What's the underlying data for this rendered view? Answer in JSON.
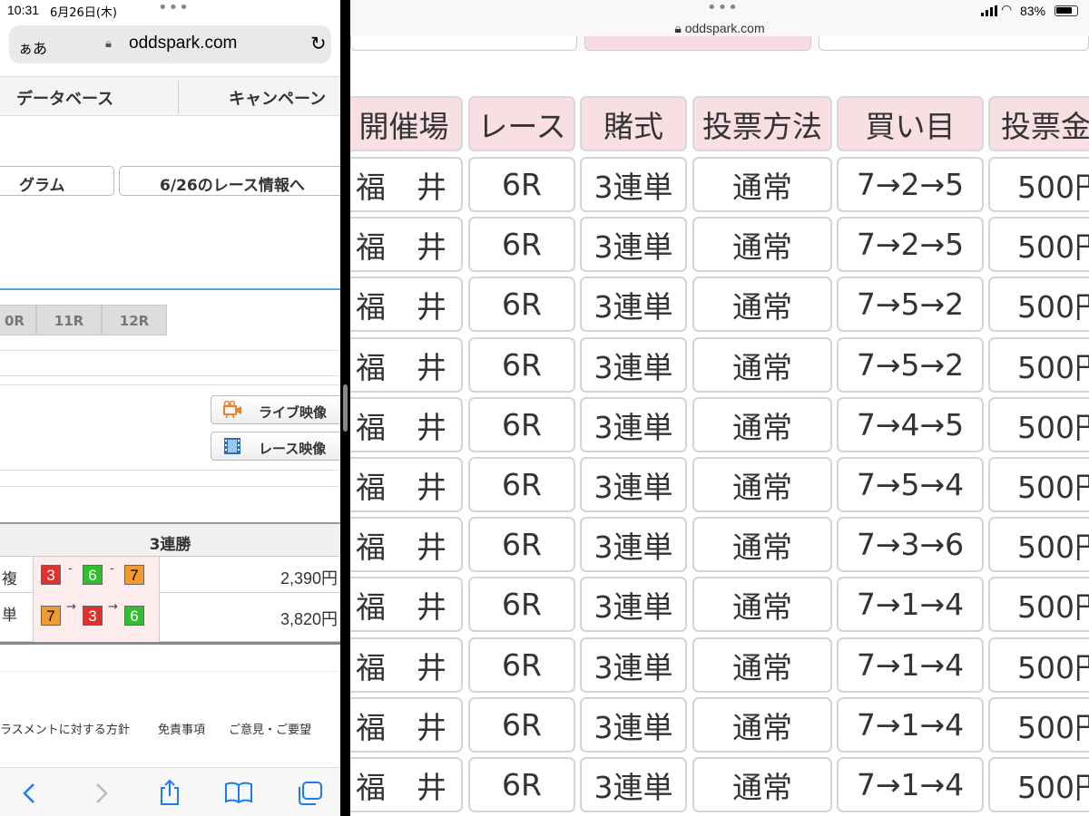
{
  "left_pane": {
    "status": {
      "time": "10:31",
      "date": "6月26日(木)"
    },
    "url_bar": {
      "aa": "ぁあ",
      "domain": "oddspark.com"
    },
    "nav_tabs": [
      "データベース",
      "キャンペーン"
    ],
    "program_buttons": [
      "グラム",
      "6/26のレース情報へ"
    ],
    "race_tabs": [
      "0R",
      "11R",
      "12R"
    ],
    "video_buttons": [
      {
        "label": "ライブ映像",
        "icon": "video-camera-icon"
      },
      {
        "label": "レース映像",
        "icon": "film-icon"
      }
    ],
    "results": {
      "header": "3連勝",
      "rows": [
        {
          "kind": "複",
          "numbers": [
            "3",
            "6",
            "7"
          ],
          "colors": [
            "#e03030",
            "#2ec02e",
            "#f29a2e"
          ],
          "separator": "-",
          "amount": "2,390円"
        },
        {
          "kind": "単",
          "numbers": [
            "7",
            "3",
            "6"
          ],
          "colors": [
            "#f29a2e",
            "#e03030",
            "#2ec02e"
          ],
          "separator": "→",
          "amount": "3,820円"
        }
      ]
    },
    "footer_links": [
      "ラスメントに対する方針",
      "免責事項",
      "ご意見・ご要望"
    ],
    "browser_toolbar": [
      "back-icon",
      "forward-icon",
      "share-icon",
      "bookmarks-icon",
      "tabs-icon"
    ]
  },
  "right_pane": {
    "status": {
      "battery": "83%",
      "battery_level": 0.83,
      "domain": "oddspark.com"
    },
    "table": {
      "headers": [
        "開催場",
        "レース",
        "賭式",
        "投票方法",
        "買い目",
        "投票金"
      ],
      "rows": [
        [
          "福井",
          "6R",
          "3連単",
          "通常",
          "7→2→5",
          "500円"
        ],
        [
          "福井",
          "6R",
          "3連単",
          "通常",
          "7→2→5",
          "500円"
        ],
        [
          "福井",
          "6R",
          "3連単",
          "通常",
          "7→5→2",
          "500円"
        ],
        [
          "福井",
          "6R",
          "3連単",
          "通常",
          "7→5→2",
          "500円"
        ],
        [
          "福井",
          "6R",
          "3連単",
          "通常",
          "7→4→5",
          "500円"
        ],
        [
          "福井",
          "6R",
          "3連単",
          "通常",
          "7→5→4",
          "500円"
        ],
        [
          "福井",
          "6R",
          "3連単",
          "通常",
          "7→3→6",
          "500円"
        ],
        [
          "福井",
          "6R",
          "3連単",
          "通常",
          "7→1→4",
          "500円"
        ],
        [
          "福井",
          "6R",
          "3連単",
          "通常",
          "7→1→4",
          "500円"
        ],
        [
          "福井",
          "6R",
          "3連単",
          "通常",
          "7→1→4",
          "500円"
        ],
        [
          "福井",
          "6R",
          "3連単",
          "通常",
          "7→1→4",
          "500円"
        ]
      ]
    }
  }
}
